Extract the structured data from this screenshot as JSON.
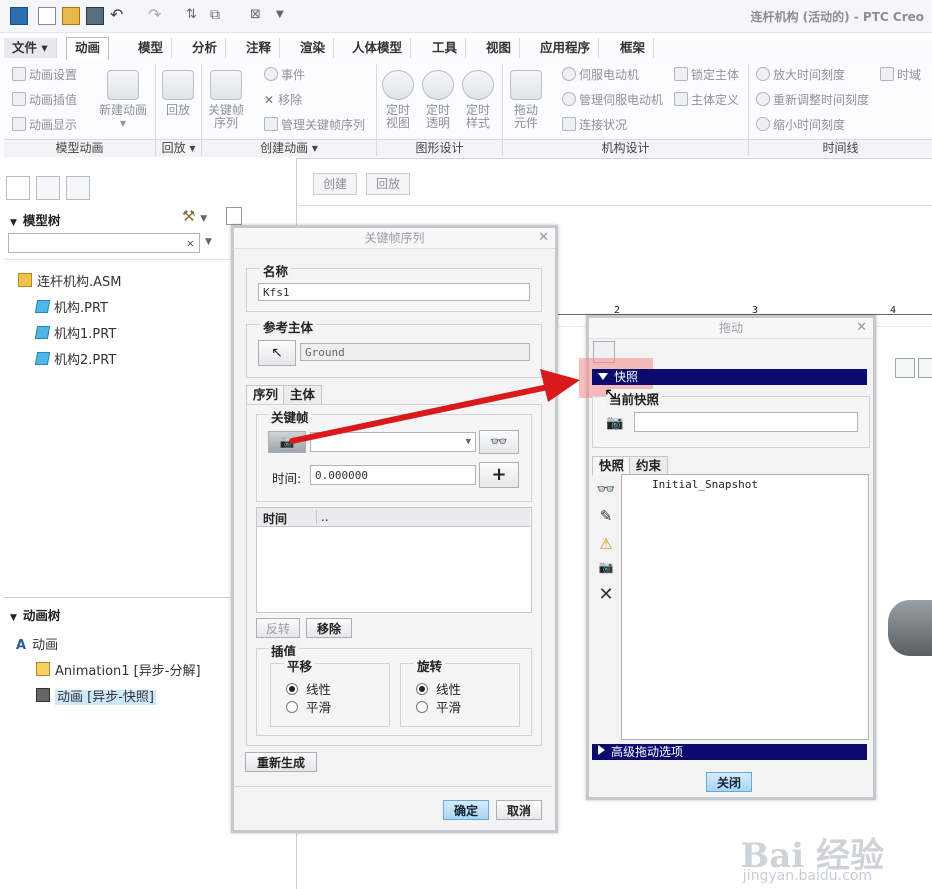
{
  "app": {
    "title": "连杆机构 (活动的) - PTC Creo"
  },
  "tabs": [
    "文件",
    "动画",
    "模型",
    "分析",
    "注释",
    "渲染",
    "人体模型",
    "工具",
    "视图",
    "应用程序",
    "框架"
  ],
  "active_tab": "动画",
  "ribbon": {
    "model_anim": {
      "items": [
        "动画设置",
        "动画插值",
        "动画显示"
      ],
      "new_anim": "新建动画",
      "label": "模型动画"
    },
    "playback": {
      "button": "回放",
      "label": "回放"
    },
    "create_anim": {
      "keyframe_seq": "关键帧\n序列",
      "event": "事件",
      "remove": "移除",
      "manage": "管理关键帧序列",
      "label": "创建动画"
    },
    "graphic_design": {
      "timed_view": "定时\n视图",
      "timed_transparency": "定时\n透明",
      "timed_style": "定时\n样式",
      "label": "图形设计"
    },
    "mech_design": {
      "drag": "拖动\n元件",
      "servo_motor": "伺服电动机",
      "manage_servo": "管理伺服电动机",
      "connection_status": "连接状况",
      "lock_body": "锁定主体",
      "body_def": "主体定义",
      "label": "机构设计"
    },
    "timeline": {
      "zoom_in": "放大时间刻度",
      "rescale": "重新调整时间刻度",
      "zoom_out": "缩小时间刻度",
      "time_domain": "时域",
      "label": "时间线"
    }
  },
  "canvas_buttons": {
    "create": "创建",
    "playback": "回放"
  },
  "ruler": [
    "2",
    "3",
    "4"
  ],
  "model_tree": {
    "header": "模型树",
    "items": [
      "连杆机构.ASM",
      "机构.PRT",
      "机构1.PRT",
      "机构2.PRT"
    ]
  },
  "anim_tree": {
    "header": "动画树",
    "root": "动画",
    "items": [
      "Animation1 [异步-分解]",
      "动画 [异步-快照]"
    ]
  },
  "keyframe_dialog": {
    "title": "关键帧序列",
    "name_label": "名称",
    "name_value": "Kfs1",
    "ref_body_label": "参考主体",
    "ref_body_value": "Ground",
    "tabs": [
      "序列",
      "主体"
    ],
    "keyframe_label": "关键帧",
    "time_label": "时间:",
    "time_value": "0.000000",
    "table_header": [
      "时间",
      ".."
    ],
    "reverse_btn": "反转",
    "remove_btn": "移除",
    "interp_label": "插值",
    "translate_label": "平移",
    "rotate_label": "旋转",
    "linear": "线性",
    "smooth": "平滑",
    "regenerate_btn": "重新生成",
    "ok_btn": "确定",
    "cancel_btn": "取消"
  },
  "drag_dialog": {
    "title": "拖动",
    "snapshot_bar": "快照",
    "current_snapshot_label": "当前快照",
    "snapshot_value": "",
    "tabs": [
      "快照",
      "约束"
    ],
    "list": [
      "Initial_Snapshot"
    ],
    "advanced_bar": "高级拖动选项",
    "close_btn": "关闭"
  },
  "watermark": {
    "brand": "Bai 经验",
    "url": "jingyan.baidu.com"
  },
  "colors": {
    "navy": "#0b0b6e",
    "arrow": "#d9191c",
    "highlight": "#f28b8b",
    "selection": "#cde8fb"
  }
}
